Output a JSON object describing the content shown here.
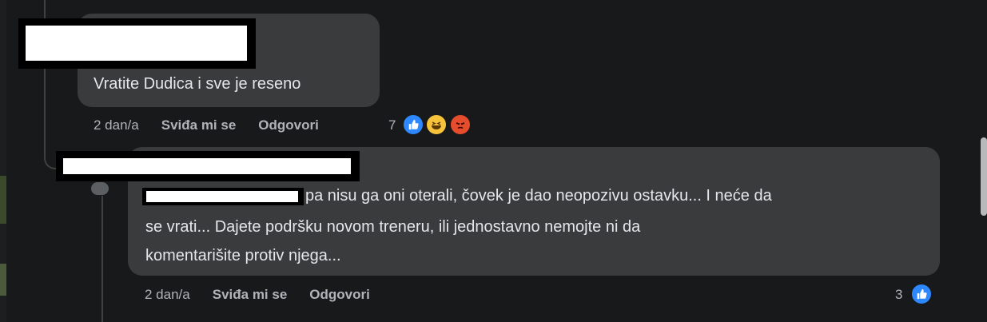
{
  "comment1": {
    "text": "Vratite Dudica i sve je reseno",
    "time": "2 dan/a",
    "like_label": "Sviđa mi se",
    "reply_label": "Odgovori",
    "reaction_count": "7",
    "reactions": [
      "like-icon",
      "haha-icon",
      "angry-icon"
    ]
  },
  "comment2": {
    "text_line1": "pa nisu ga oni oterali, čovek je dao neopozivu ostavku... I neće da",
    "text_line2": "se vrati... Dajete podršku novom treneru, ili jednostavno nemojte ni da",
    "text_line3": "komentarišite protiv njega...",
    "time": "2 dan/a",
    "like_label": "Sviđa mi se",
    "reply_label": "Odgovori",
    "reaction_count": "3",
    "reactions": [
      "like-icon"
    ]
  },
  "colors": {
    "background": "#18191a",
    "bubble": "#3a3b3c",
    "text": "#e4e6eb",
    "secondary_text": "#b0b3b8",
    "like_blue": "#2d88ff",
    "haha_yellow": "#f7c33b",
    "angry_red": "#e64d2c"
  }
}
